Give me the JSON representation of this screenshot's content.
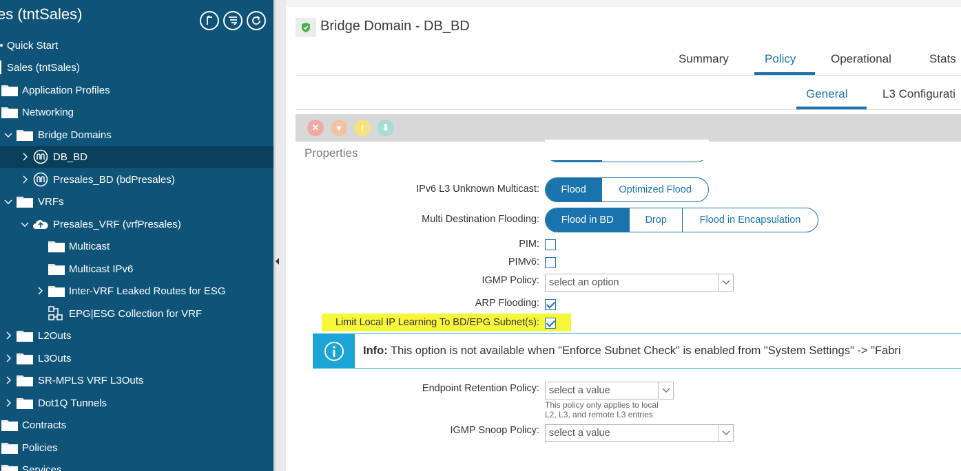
{
  "sidebar": {
    "title": "es (tntSales)",
    "items": [
      {
        "label": "Quick Start"
      },
      {
        "label": "Sales (tntSales)"
      },
      {
        "label": "Application Profiles"
      },
      {
        "label": "Networking"
      },
      {
        "label": "Bridge Domains"
      },
      {
        "label": "DB_BD"
      },
      {
        "label": "Presales_BD (bdPresales)"
      },
      {
        "label": "VRFs"
      },
      {
        "label": "Presales_VRF (vrfPresales)"
      },
      {
        "label": "Multicast"
      },
      {
        "label": "Multicast IPv6"
      },
      {
        "label": "Inter-VRF Leaked Routes for ESG"
      },
      {
        "label": "EPG|ESG Collection for VRF"
      },
      {
        "label": "L2Outs"
      },
      {
        "label": "L3Outs"
      },
      {
        "label": "SR-MPLS VRF L3Outs"
      },
      {
        "label": "Dot1Q Tunnels"
      },
      {
        "label": "Contracts"
      },
      {
        "label": "Policies"
      },
      {
        "label": "Services"
      }
    ]
  },
  "header": {
    "title": "Bridge Domain - DB_BD"
  },
  "tabs": [
    {
      "label": "Summary"
    },
    {
      "label": "Policy"
    },
    {
      "label": "Operational"
    },
    {
      "label": "Stats"
    }
  ],
  "subtabs": [
    {
      "label": "General"
    },
    {
      "label": "L3 Configurati"
    }
  ],
  "properties": {
    "title": "Properties",
    "ipv6_l3_unknown_multicast": {
      "label": "IPv6 L3 Unknown Multicast:",
      "options": [
        "Flood",
        "Optimized Flood"
      ],
      "selected": "Flood"
    },
    "multi_destination_flooding": {
      "label": "Multi Destination Flooding:",
      "options": [
        "Flood in BD",
        "Drop",
        "Flood in Encapsulation"
      ],
      "selected": "Flood in BD"
    },
    "pim": {
      "label": "PIM:",
      "checked": false
    },
    "pimv6": {
      "label": "PIMv6:",
      "checked": false
    },
    "igmp_policy": {
      "label": "IGMP Policy:",
      "placeholder": "select an option"
    },
    "arp_flooding": {
      "label": "ARP Flooding:",
      "checked": true
    },
    "limit_local_ip": {
      "label": "Limit Local IP Learning To BD/EPG Subnet(s):",
      "checked": true
    },
    "info": {
      "bold": "Info:",
      "text": "This option is not available when \"Enforce Subnet Check\" is enabled from \"System Settings\" -> \"Fabri"
    },
    "endpoint_retention": {
      "label": "Endpoint Retention Policy:",
      "placeholder": "select a value",
      "hint_line1": "This policy only applies to local",
      "hint_line2": "L2, L3, and remote L3 entries"
    },
    "igmp_snoop": {
      "label": "IGMP Snoop Policy:",
      "placeholder": "select a value"
    }
  },
  "colors": {
    "sidebar": "#0f5478",
    "accent": "#1a73ad",
    "info": "#1ba5d6",
    "highlight": "#f6f63a"
  }
}
